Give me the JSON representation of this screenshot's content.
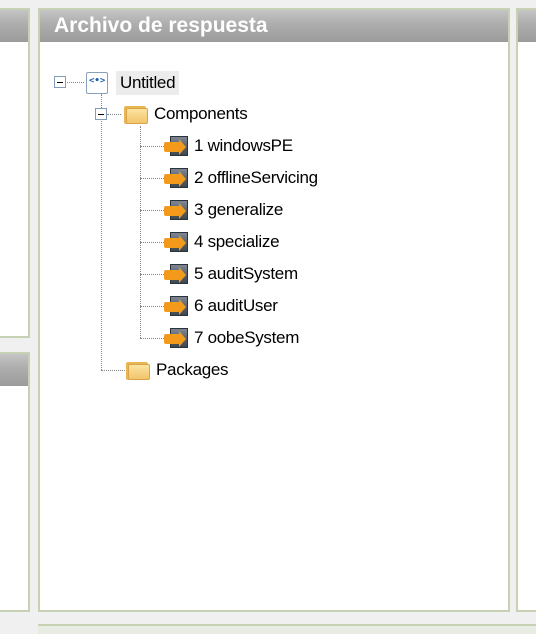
{
  "main_panel": {
    "title": "Archivo de respuesta",
    "tree": {
      "root": {
        "label": "Untitled",
        "icon": "answer-file-icon",
        "expanded": true
      },
      "components": {
        "label": "Components",
        "icon": "folder-icon",
        "expanded": true
      },
      "passes": [
        {
          "label": "1 windowsPE",
          "icon": "configuration-pass-icon"
        },
        {
          "label": "2 offlineServicing",
          "icon": "configuration-pass-icon"
        },
        {
          "label": "3 generalize",
          "icon": "configuration-pass-icon"
        },
        {
          "label": "4 specialize",
          "icon": "configuration-pass-icon"
        },
        {
          "label": "5 auditSystem",
          "icon": "configuration-pass-icon"
        },
        {
          "label": "6 auditUser",
          "icon": "configuration-pass-icon"
        },
        {
          "label": "7 oobeSystem",
          "icon": "configuration-pass-icon"
        }
      ],
      "packages": {
        "label": "Packages",
        "icon": "folder-icon"
      }
    }
  },
  "colors": {
    "panel_border": "#c7d1b4",
    "header_gradient_top": "#c4c4c4",
    "header_gradient_bottom": "#9b9b9b",
    "header_text": "#ffffff"
  }
}
